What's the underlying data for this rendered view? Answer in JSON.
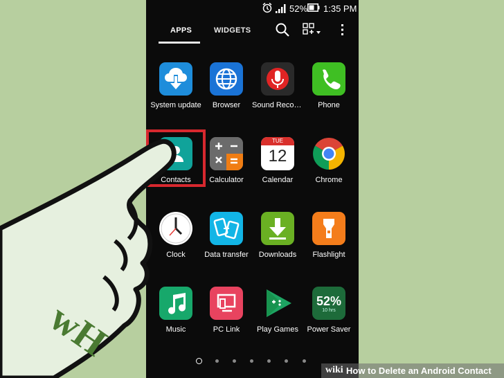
{
  "status_bar": {
    "battery_percent": "52%",
    "time": "1:35 PM"
  },
  "tabs": {
    "apps": "APPS",
    "widgets": "WIDGETS"
  },
  "apps": [
    {
      "label": "System update"
    },
    {
      "label": "Browser"
    },
    {
      "label": "Sound Record…"
    },
    {
      "label": "Phone"
    },
    {
      "label": "Contacts"
    },
    {
      "label": "Calculator"
    },
    {
      "label": "Calendar"
    },
    {
      "label": "Chrome"
    },
    {
      "label": "Clock"
    },
    {
      "label": "Data transfer"
    },
    {
      "label": "Downloads"
    },
    {
      "label": "Flashlight"
    },
    {
      "label": "Music"
    },
    {
      "label": "PC Link"
    },
    {
      "label": "Play Games"
    },
    {
      "label": "Power Saver"
    }
  ],
  "calendar_icon": {
    "month": "TUE",
    "day": "12"
  },
  "power_saver_icon": {
    "percent": "52%",
    "hours": "10 hrs"
  },
  "watermark": {
    "logo": "wH",
    "site": "wiki",
    "title": "How to Delete an Android Contact"
  },
  "colors": {
    "highlight": "#d7282e",
    "background": "#b7cf9f"
  }
}
